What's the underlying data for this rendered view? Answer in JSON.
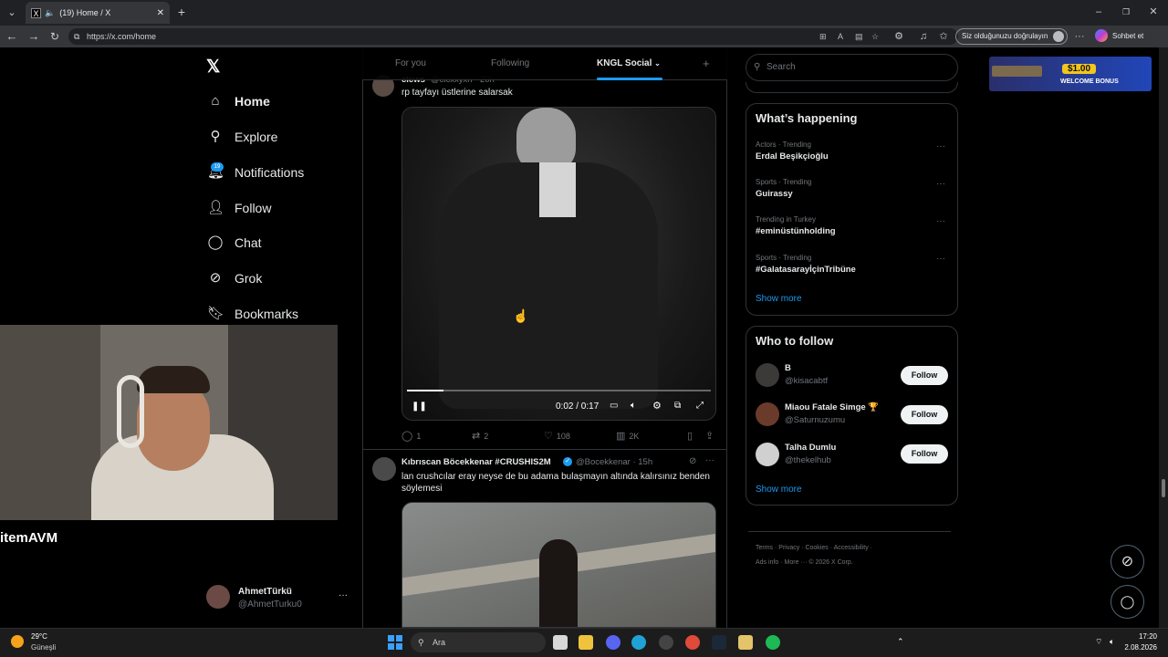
{
  "browser": {
    "tab_title": "(19) Home / X",
    "url": "https://x.com/home",
    "verify_label": "Siz olduğunuzu doğrulayın",
    "copilot_label": "Sohbet et"
  },
  "nav": {
    "items": [
      {
        "label": "Home",
        "icon": "home-icon"
      },
      {
        "label": "Explore",
        "icon": "search-icon"
      },
      {
        "label": "Notifications",
        "icon": "bell-icon",
        "badge": "19"
      },
      {
        "label": "Follow",
        "icon": "add-person-icon"
      },
      {
        "label": "Chat",
        "icon": "chat-icon"
      },
      {
        "label": "Grok",
        "icon": "grok-icon"
      },
      {
        "label": "Bookmarks",
        "icon": "bookmark-icon"
      }
    ]
  },
  "overlay": {
    "brand": "itemAVM"
  },
  "account": {
    "name": "AhmetTürkü",
    "handle": "@AhmetTurku0",
    "more": "···"
  },
  "timeline": {
    "tabs": [
      "For you",
      "Following",
      "KNGL Social"
    ],
    "plus": "+",
    "post1": {
      "author_fragment": "cicws",
      "handle_fragment": "@cicxxyxn · 20h",
      "text": "rp tayfayı üstlerine salarsak",
      "video_time": "0:02 / 0:17",
      "video_progress": 0.12,
      "stats": {
        "replies": "1",
        "reposts": "2",
        "likes": "108",
        "views": "2K"
      }
    },
    "post2": {
      "author": "Kıbrıscan Böcekkenar #CRUSHIS2M",
      "handle": "@Bocekkenar · 15h",
      "text": "lan crushcılar eray neyse de bu adama bulaşmayın altında kalırsınız benden söylemesi"
    }
  },
  "sidebar": {
    "search_placeholder": "Search",
    "happening_title": "What’s happening",
    "trends": [
      {
        "meta": "Actors · Trending",
        "name": "Erdal Beşikçioğlu"
      },
      {
        "meta": "Sports · Trending",
        "name": "Guirassy"
      },
      {
        "meta": "Trending in Turkey",
        "name": "#eminüstünholding"
      },
      {
        "meta": "Sports · Trending",
        "name": "#GalatasarayİçinTribüne"
      }
    ],
    "show_more": "Show more",
    "who_title": "Who to follow",
    "suggestions": [
      {
        "name": "B",
        "handle": "@kisacabtf"
      },
      {
        "name": "Miaou Fatale Simge 🏆",
        "handle": "@Saturnuzumu"
      },
      {
        "name": "Talha Dumlu",
        "handle": "@thekelhub"
      }
    ],
    "follow_label": "Follow",
    "footer_line1": "Terms · Privacy · Cookies · Accessibility ·",
    "footer_line2": "Ads info · More ··· © 2026 X Corp."
  },
  "ad": {
    "amount": "$1.00",
    "text": "WELCOME BONUS"
  },
  "taskbar": {
    "temp": "29°C",
    "weather": "Güneşli",
    "search": "Ara",
    "time": "17:20",
    "date": "2.08.2026"
  }
}
